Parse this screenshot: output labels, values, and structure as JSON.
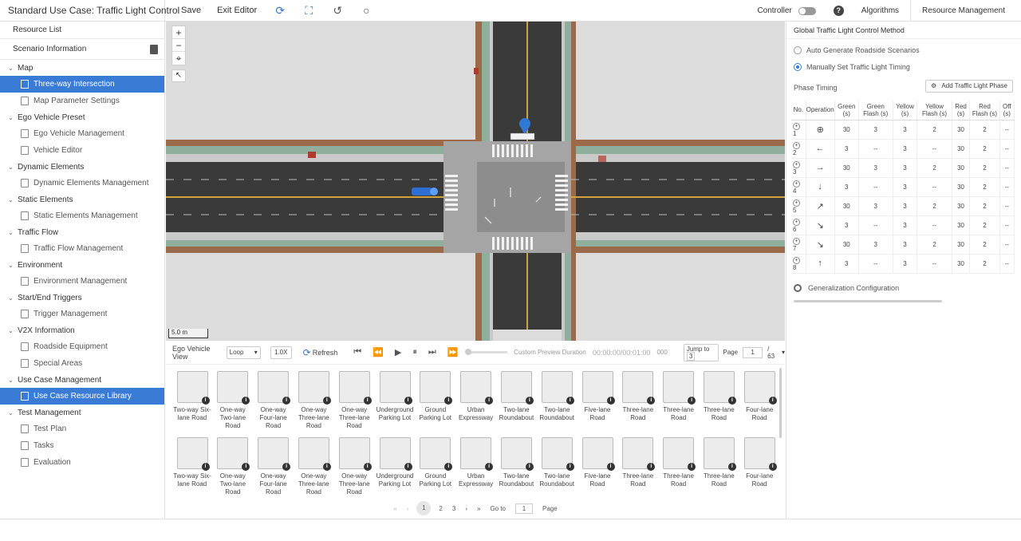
{
  "header": {
    "title": "Standard Use Case: Traffic Light Control",
    "save": "Save",
    "exit_editor": "Exit Editor",
    "controller": "Controller",
    "algorithms": "Algorithms",
    "resource_management": "Resource Management",
    "help": "?"
  },
  "sidebar": {
    "title": "Resource List",
    "scenario_info": "Scenario Information",
    "groups": [
      {
        "label": "Map",
        "items": [
          "Three-way Intersection",
          "Map Parameter Settings"
        ]
      },
      {
        "label": "Ego Vehicle Preset",
        "items": [
          "Ego Vehicle Management",
          "Vehicle Editor"
        ]
      },
      {
        "label": "Dynamic Elements",
        "items": [
          "Dynamic Elements Management"
        ]
      },
      {
        "label": "Static Elements",
        "items": [
          "Static Elements Management"
        ]
      },
      {
        "label": "Traffic Flow",
        "items": [
          "Traffic Flow Management"
        ]
      },
      {
        "label": "Environment",
        "items": [
          "Environment Management"
        ]
      },
      {
        "label": "Start/End Triggers",
        "items": [
          "Trigger Management"
        ]
      },
      {
        "label": "V2X Information",
        "items": [
          "Roadside Equipment",
          "Special Areas"
        ]
      },
      {
        "label": "Use Case Management",
        "items": [
          "Use Case Resource Library"
        ]
      },
      {
        "label": "Test Management",
        "items": [
          "Test Plan",
          "Tasks",
          "Evaluation"
        ]
      }
    ]
  },
  "map": {
    "scale": "5.0 m",
    "zoom_in": "+",
    "zoom_out": "−",
    "locate": "⌖",
    "select": "↖"
  },
  "playback": {
    "view_label": "Ego Vehicle View",
    "mode": "Loop",
    "speed": "1.0X",
    "refresh": "Refresh",
    "custom_duration": "Custom Preview Duration",
    "time": "00:00:00/00:01:00",
    "frames": "000",
    "jump_to": "Jump to",
    "jump_value": "3",
    "page_label": "Page",
    "page_current": "1",
    "page_total": "/ 63"
  },
  "library": {
    "row1": [
      "Two-way Six-lane Road",
      "One-way Two-lane Road",
      "One-way Four-lane Road",
      "One-way Three-lane Road",
      "One-way Three-lane Road",
      "Underground Parking Lot",
      "Ground Parking Lot",
      "Urban Expressway",
      "Two-lane Roundabout",
      "Two-lane Roundabout",
      "Five-lane Road",
      "Three-lane Road",
      "Three-lane Road",
      "Three-lane Road",
      "Four-lane Road"
    ],
    "row2": [
      "Two-way Six-lane Road",
      "One-way Two-lane Road",
      "One-way Four-lane Road",
      "One-way Three-lane Road",
      "One-way Three-lane Road",
      "Underground Parking Lot",
      "Ground Parking Lot",
      "Urban Expressway",
      "Two-lane Roundabout",
      "Two-lane Roundabout",
      "Five-lane Road",
      "Three-lane Road",
      "Three-lane Road",
      "Three-lane Road",
      "Four-lane Road"
    ],
    "pager": {
      "first": "«",
      "prev": "‹",
      "pages": [
        "1",
        "2",
        "3"
      ],
      "next": "›",
      "last": "»",
      "goto": "Go to",
      "goto_value": "1",
      "page": "Page"
    }
  },
  "right_panel": {
    "title": "Global Traffic Light Control Method",
    "option_auto": "Auto Generate Roadside Scenarios",
    "option_manual": "Manually Set Traffic Light Timing",
    "selected_option": "manual",
    "phase_timing": "Phase Timing",
    "add_phase": "Add Traffic Light Phase",
    "columns": [
      "No.",
      "Operation",
      "Green (s)",
      "Green Flash (s)",
      "Yellow (s)",
      "Yellow Flash (s)",
      "Red (s)",
      "Red Flash (s)",
      "Off (s)"
    ],
    "rows": [
      {
        "no": "1",
        "op": "⊕",
        "green": "30",
        "gflash": "3",
        "yellow": "3",
        "yflash": "2",
        "red": "30",
        "rflash": "2",
        "off": "--"
      },
      {
        "no": "2",
        "op": "←",
        "green": "3",
        "gflash": "--",
        "yellow": "3",
        "yflash": "--",
        "red": "30",
        "rflash": "2",
        "off": "--"
      },
      {
        "no": "3",
        "op": "→",
        "green": "30",
        "gflash": "3",
        "yellow": "3",
        "yflash": "2",
        "red": "30",
        "rflash": "2",
        "off": "--"
      },
      {
        "no": "4",
        "op": "↓",
        "green": "3",
        "gflash": "--",
        "yellow": "3",
        "yflash": "--",
        "red": "30",
        "rflash": "2",
        "off": "--"
      },
      {
        "no": "5",
        "op": "↗",
        "green": "30",
        "gflash": "3",
        "yellow": "3",
        "yflash": "2",
        "red": "30",
        "rflash": "2",
        "off": "--"
      },
      {
        "no": "6",
        "op": "↘",
        "green": "3",
        "gflash": "--",
        "yellow": "3",
        "yflash": "--",
        "red": "30",
        "rflash": "2",
        "off": "--"
      },
      {
        "no": "7",
        "op": "↘",
        "green": "30",
        "gflash": "3",
        "yellow": "3",
        "yflash": "2",
        "red": "30",
        "rflash": "2",
        "off": "--"
      },
      {
        "no": "8",
        "op": "↑",
        "green": "3",
        "gflash": "--",
        "yellow": "3",
        "yflash": "--",
        "red": "30",
        "rflash": "2",
        "off": "--"
      }
    ],
    "generalization": "Generalization Configuration"
  }
}
